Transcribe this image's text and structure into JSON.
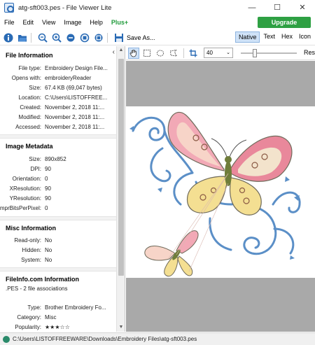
{
  "window": {
    "title": "atg-sft003.pes - File Viewer Lite",
    "minimize": "—",
    "maximize": "☐",
    "close": "✕"
  },
  "menu": {
    "items": [
      "File",
      "Edit",
      "View",
      "Image",
      "Help"
    ],
    "plus": "Plus+",
    "upgrade": "Upgrade"
  },
  "toolbar": {
    "save_as": "Save As...",
    "view_tabs": [
      "Native",
      "Text",
      "Hex",
      "Icon"
    ],
    "active_view": "Native"
  },
  "view_toolbar": {
    "zoom_value": "40",
    "reset_label": "Res"
  },
  "file_information": {
    "title": "File Information",
    "rows": [
      {
        "k": "File type:",
        "v": "Embroidery Design File..."
      },
      {
        "k": "Opens with:",
        "v": "embroideryReader"
      },
      {
        "k": "Size:",
        "v": "67.4 KB (69,047 bytes)"
      },
      {
        "k": "Location:",
        "v": "C:\\Users\\LISTOFFREE..."
      },
      {
        "k": "Created:",
        "v": "November 2, 2018 11:..."
      },
      {
        "k": "Modified:",
        "v": "November 2, 2018 11:..."
      },
      {
        "k": "Accessed:",
        "v": "November 2, 2018 11:..."
      }
    ]
  },
  "image_metadata": {
    "title": "Image Metadata",
    "rows": [
      {
        "k": "Size:",
        "v": "890x852"
      },
      {
        "k": "DPI:",
        "v": "90"
      },
      {
        "k": "Orientation:",
        "v": "0"
      },
      {
        "k": "XResolution:",
        "v": "90"
      },
      {
        "k": "YResolution:",
        "v": "90"
      },
      {
        "k": "ComprBitsPerPixel:",
        "v": "0"
      }
    ]
  },
  "misc_information": {
    "title": "Misc Information",
    "rows": [
      {
        "k": "Read-only:",
        "v": "No"
      },
      {
        "k": "Hidden:",
        "v": "No"
      },
      {
        "k": "System:",
        "v": "No"
      }
    ]
  },
  "fileinfo_com": {
    "title": "FileInfo.com Information",
    "subtitle": ".PES - 2 file associations",
    "rows": [
      {
        "k": "Type:",
        "v": "Brother Embroidery Fo..."
      },
      {
        "k": "Category:",
        "v": "Misc"
      },
      {
        "k": "Popularity:",
        "v": "★★★☆☆"
      }
    ]
  },
  "status": {
    "path": "C:\\Users\\LISTOFFREEWARE\\Downloads\\Embroidery Files\\atg-sft003.pes"
  },
  "colors": {
    "accent": "#2ea043",
    "pink": "#e9889b",
    "yellow": "#f4df92",
    "blue_swirl": "#5b8fc7",
    "olive": "#6f7d3a"
  }
}
